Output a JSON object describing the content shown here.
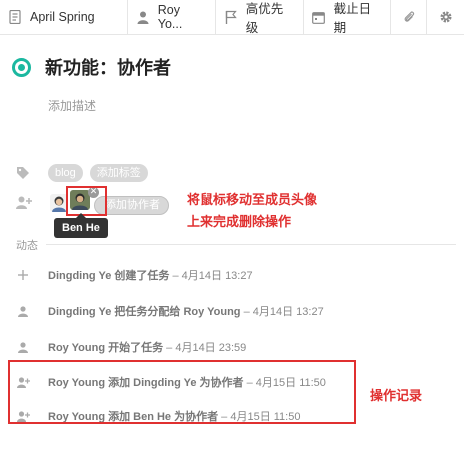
{
  "topbar": {
    "project": "April Spring",
    "assignee": "Roy Yo...",
    "priority": "高优先级",
    "deadline": "截止日期"
  },
  "task": {
    "title": "新功能：协作者",
    "description_placeholder": "添加描述"
  },
  "tags": {
    "items": [
      "blog"
    ],
    "add_label": "添加标签"
  },
  "members": {
    "add_label": "添加协作者",
    "hover_tooltip": "Ben He",
    "annotation": "将鼠标移动至成员头像上来完成删除操作"
  },
  "activity": {
    "label": "动态",
    "items": [
      {
        "icon": "plus-icon",
        "text": "Dingding Ye 创建了任务",
        "time": "– 4月14日 13:27"
      },
      {
        "icon": "user-icon",
        "text": "Dingding Ye 把任务分配给 Roy Young",
        "time": "– 4月14日 13:27"
      },
      {
        "icon": "user-icon",
        "text": "Roy Young 开始了任务",
        "time": "– 4月14日 23:59"
      },
      {
        "icon": "add-user-icon",
        "text": "Roy Young 添加 Dingding Ye 为协作者",
        "time": "– 4月15日 11:50"
      },
      {
        "icon": "add-user-icon",
        "text": "Roy Young 添加 Ben He 为协作者",
        "time": "– 4月15日 11:50"
      }
    ],
    "annotation": "操作记录"
  },
  "colors": {
    "accent": "#1bb8a0",
    "annotation_red": "#e03030",
    "pill_gray": "#d8d8d8"
  }
}
